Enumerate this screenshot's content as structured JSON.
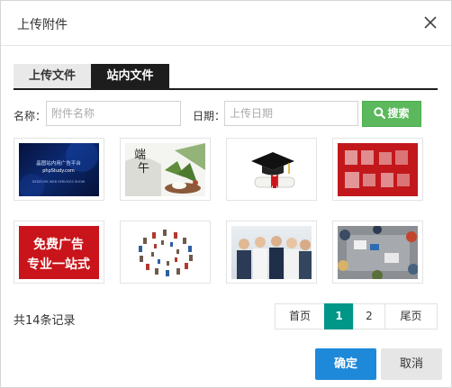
{
  "dialog": {
    "title": "上传附件",
    "close_icon": "close-icon"
  },
  "tabs": [
    {
      "label": "上传文件",
      "active": false
    },
    {
      "label": "站内文件",
      "active": true
    }
  ],
  "filters": {
    "name_label": "名称：",
    "name_placeholder": "附件名称",
    "name_value": "",
    "date_label": "日期：",
    "date_placeholder": "上传日期",
    "date_value": "",
    "search_label": "搜索",
    "search_icon": "search-icon",
    "search_color": "#5cb85c"
  },
  "thumbnails": [
    {
      "subject": "blue tech banner",
      "lines": [
        "晶图站内用广告平台",
        "phpStudy.com",
        "DEDECMS WEB SERVICES SHOW"
      ]
    },
    {
      "subject": "zongzi dragon boat festival",
      "lines": [
        "端",
        "午"
      ]
    },
    {
      "subject": "graduation cap with diploma"
    },
    {
      "subject": "red blurred advertisement"
    },
    {
      "subject": "red advertisement banner",
      "lines": [
        "免费广告",
        "专业一站式"
      ]
    },
    {
      "subject": "spiral of people photos"
    },
    {
      "subject": "business team portrait"
    },
    {
      "subject": "office meeting top view"
    }
  ],
  "pagination": {
    "total_text": "共14条记录",
    "first": "首页",
    "pages": [
      "1",
      "2"
    ],
    "current": "1",
    "last": "尾页",
    "active_color": "#009688"
  },
  "footer": {
    "confirm": "确定",
    "cancel": "取消",
    "confirm_color": "#1e88d9"
  }
}
